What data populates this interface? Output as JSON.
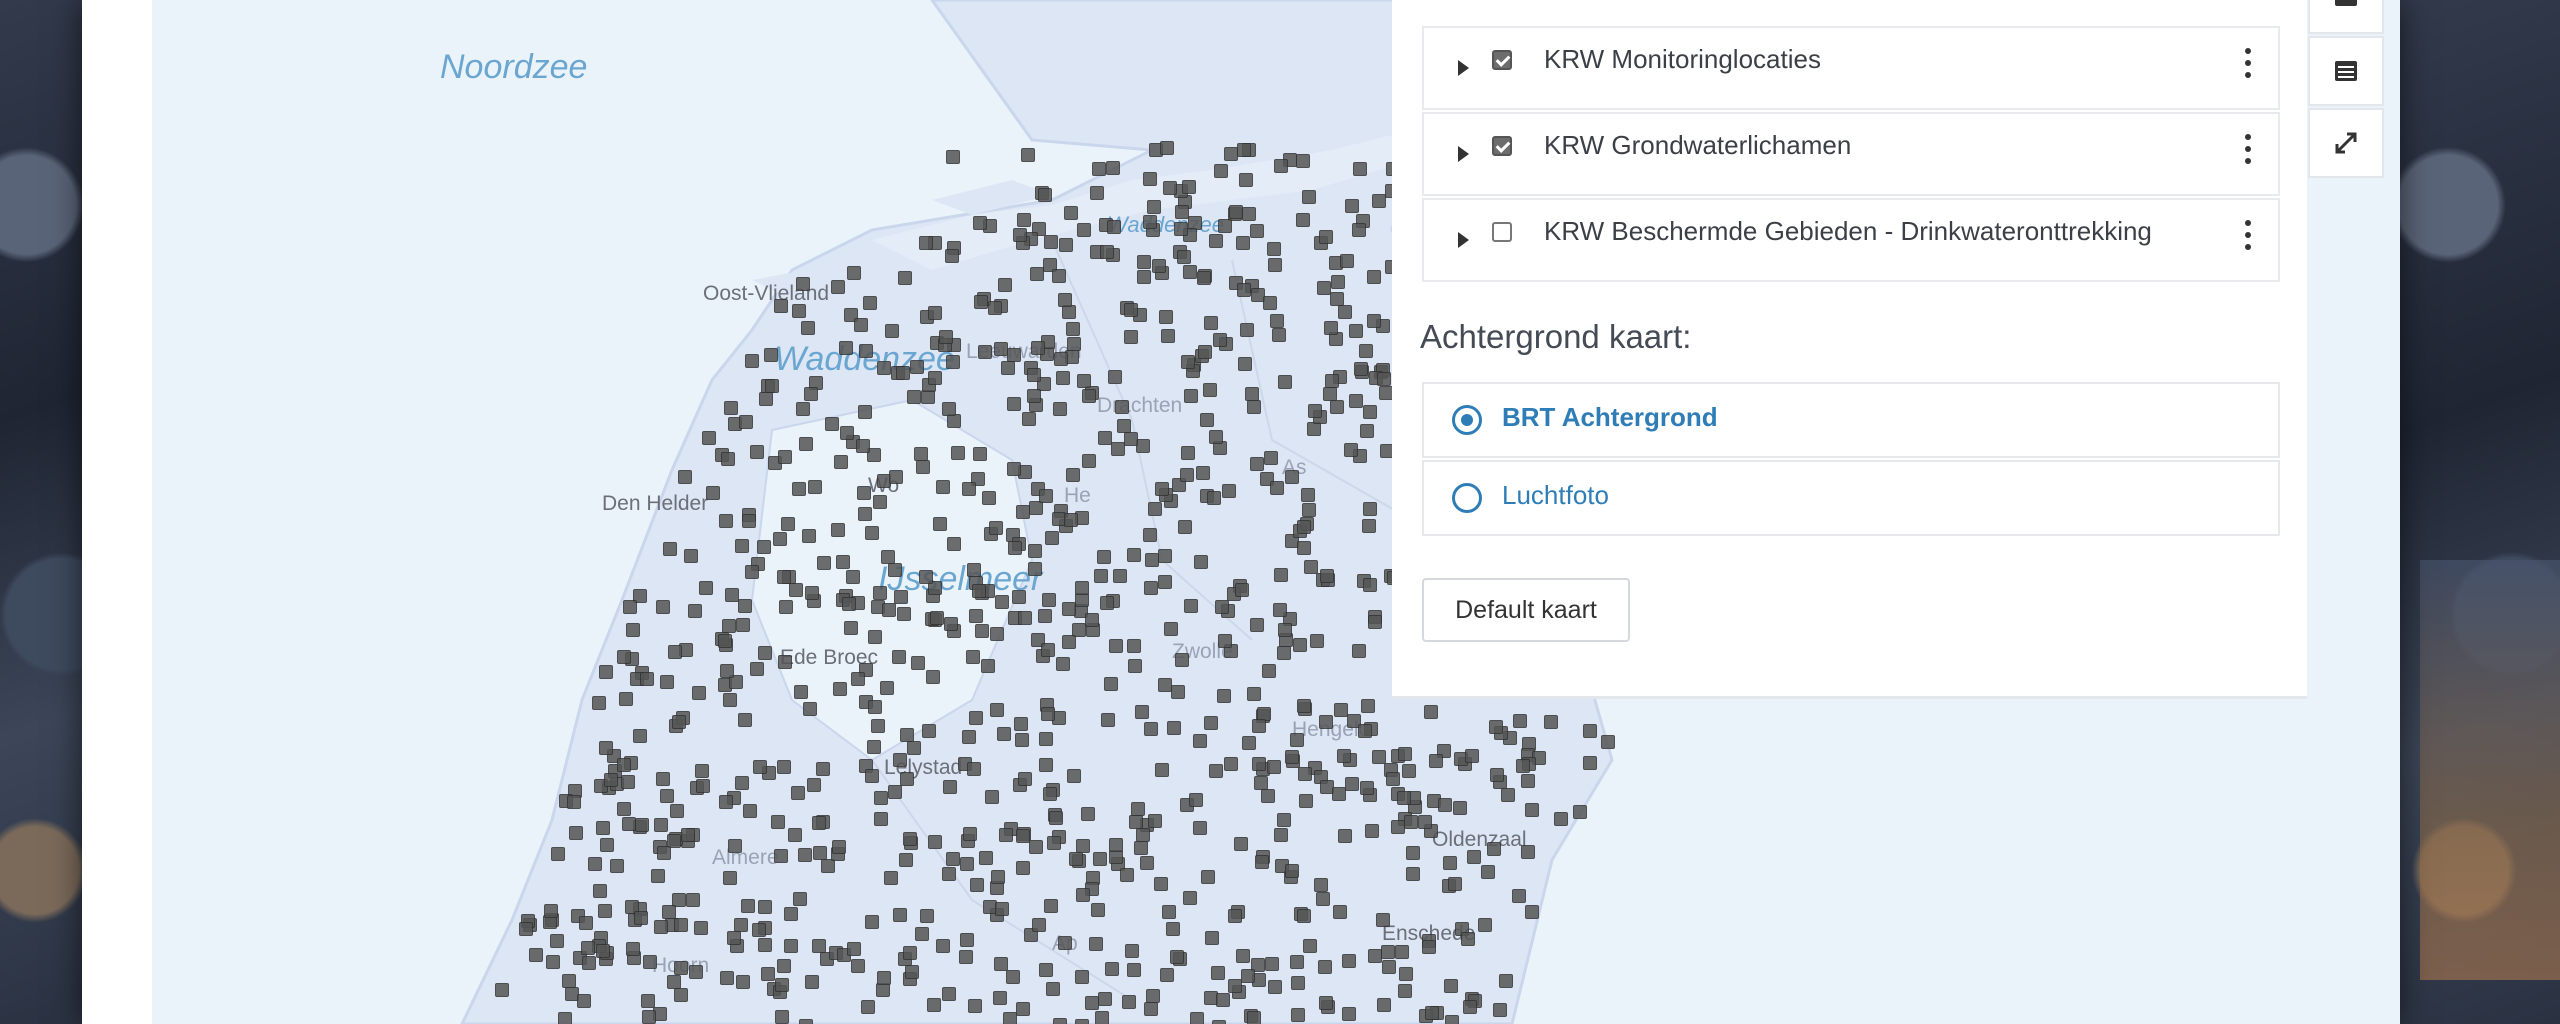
{
  "map": {
    "sea_labels": {
      "noordzee": "Noordzee",
      "waddenzee_top": "Waddenzee",
      "waddenzee": "Waddenzee",
      "ijsselmeer": "IJsselmeer"
    },
    "places": {
      "oostvlieland": "Oost-Vlieland",
      "leeuwarden": "Leeuwarden",
      "drachten": "Drachten",
      "den_helder": "Den Helder",
      "workum": "Wo",
      "heerenveen": "He",
      "enkhuizen": "Ede Broec",
      "lelystad": "Lelystad",
      "almere": "Almere",
      "apeldoorn": "Ap",
      "hengelo": "Hengelo",
      "oldenzaal": "Oldenzaal",
      "enschede": "Enschede",
      "zwolle": "Zwolle",
      "assen": "As",
      "hoorn": "Hoorn"
    }
  },
  "layers": [
    {
      "label": "KRW Monitoringlocaties",
      "checked": true
    },
    {
      "label": "KRW Grondwaterlichamen",
      "checked": true
    },
    {
      "label": "KRW Beschermde Gebieden - Drinkwateronttrekking",
      "checked": false
    }
  ],
  "background": {
    "title": "Achtergrond kaart:",
    "options": [
      {
        "label": "BRT Achtergrond",
        "selected": true
      },
      {
        "label": "Luchtfoto",
        "selected": false
      }
    ]
  },
  "default_button": "Default kaart",
  "tools": [
    "layers-icon",
    "legend-icon",
    "expand-icon"
  ]
}
